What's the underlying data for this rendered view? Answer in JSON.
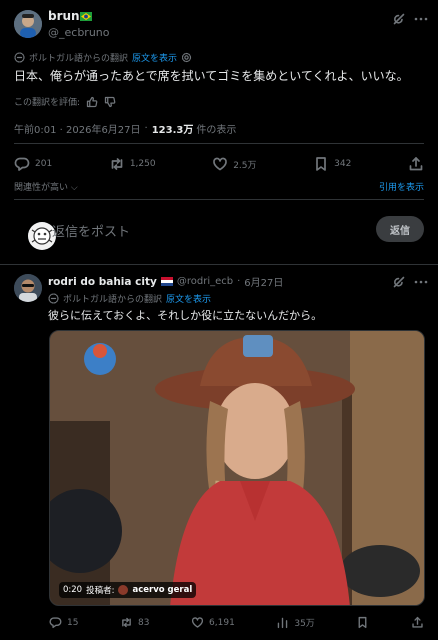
{
  "post": {
    "name": "bruno",
    "handle": "@_ecbruno",
    "translation": {
      "note": "ポルトガル語からの翻訳",
      "show_original": "原文を表示"
    },
    "text": "日本、俺らが通ったあとで席を拭いてゴミを集めといてくれよ、いいな。",
    "rate_label": "この翻訳を評価:",
    "timestamp": "午前0:01 · 2026年6月27日",
    "views_number": "123.3万",
    "views_label": "件の表示",
    "actions": {
      "replies": "201",
      "reposts": "1,250",
      "likes": "2.5万",
      "bookmarks": "342"
    },
    "relevance": "関連性が高い",
    "quotes_link": "引用を表示"
  },
  "reply_box": {
    "placeholder": "返信をポスト",
    "button": "返信"
  },
  "reply": {
    "name": "rodri do bahia city",
    "handle": "@rodri_ecb",
    "date": "6月27日",
    "translation": {
      "note": "ポルトガル語からの翻訳",
      "show_original": "原文を表示"
    },
    "text": "彼らに伝えておくよ、それしか役に立たないんだから。",
    "media": {
      "time": "0:20",
      "poster_label": "投稿者:",
      "poster_name": "acervo geral"
    },
    "actions": {
      "replies": "15",
      "reposts": "83",
      "likes": "6,191",
      "views": "35万"
    }
  },
  "colors": {
    "background": "#000000",
    "text": "#e7e9ea",
    "muted": "#71767b",
    "link": "#1d9bf0",
    "border": "#2f3336"
  }
}
